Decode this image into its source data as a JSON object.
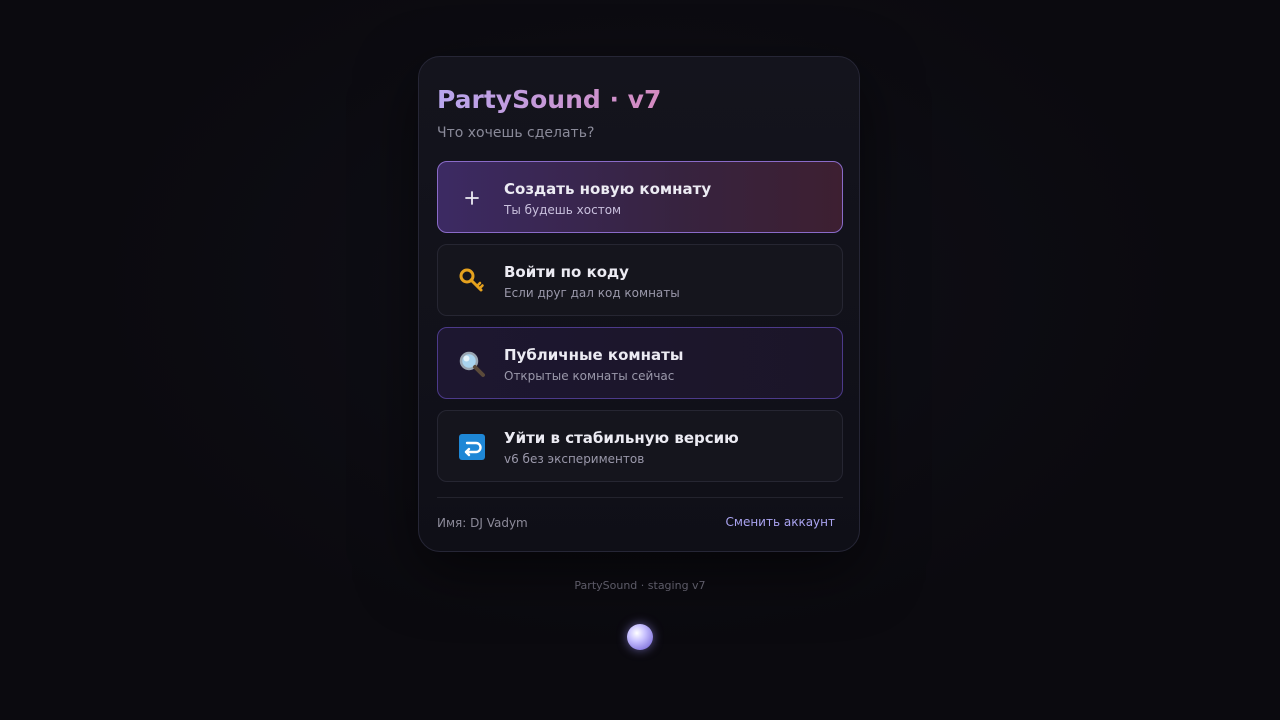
{
  "app": {
    "title": "PartySound · v7",
    "subtitle": "Что хочешь сделать?"
  },
  "options": [
    {
      "title": "Создать новую комнату",
      "subtitle": "Ты будешь хостом",
      "icon": "plus-icon"
    },
    {
      "title": "Войти по коду",
      "subtitle": "Если друг дал код комнаты",
      "icon": "key-icon"
    },
    {
      "title": "Публичные комнаты",
      "subtitle": "Открытые комнаты сейчас",
      "icon": "magnifier-icon"
    },
    {
      "title": "Уйти в стабильную версию",
      "subtitle": "v6 без экспериментов",
      "icon": "return-arrow-icon"
    }
  ],
  "footer": {
    "name": "Имя: DJ Vadym",
    "switch_account": "Сменить аккаунт"
  },
  "caption": "PartySound · staging v7",
  "colors": {
    "accent": "#a9a3f0",
    "primary_gradient_start": "#3c2a63",
    "primary_gradient_end": "#3d1f31",
    "background": "#0b0a0f"
  }
}
